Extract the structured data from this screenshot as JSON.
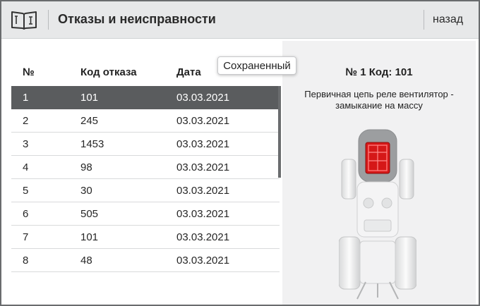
{
  "header": {
    "title": "Отказы и неисправности",
    "back_label": "назад"
  },
  "table": {
    "columns": [
      "№",
      "Код отказа",
      "Дата"
    ],
    "rows": [
      {
        "num": "1",
        "code": "101",
        "date": "03.03.2021"
      },
      {
        "num": "2",
        "code": "245",
        "date": "03.03.2021"
      },
      {
        "num": "3",
        "code": "1453",
        "date": "03.03.2021"
      },
      {
        "num": "4",
        "code": "98",
        "date": "03.03.2021"
      },
      {
        "num": "5",
        "code": "30",
        "date": "03.03.2021"
      },
      {
        "num": "6",
        "code": "505",
        "date": "03.03.2021"
      },
      {
        "num": "7",
        "code": "101",
        "date": "03.03.2021"
      },
      {
        "num": "8",
        "code": "48",
        "date": "03.03.2021"
      }
    ],
    "selected_index": 0
  },
  "tooltip": "Сохраненный",
  "detail": {
    "title": "№ 1 Код: 101",
    "description": "Первичная цепь реле вентилятор - замыкание на массу",
    "highlight_color": "#e01818"
  },
  "icons": {
    "header_icon": "manual-book-icon",
    "vehicle_image": "tractor-top-view-icon"
  }
}
